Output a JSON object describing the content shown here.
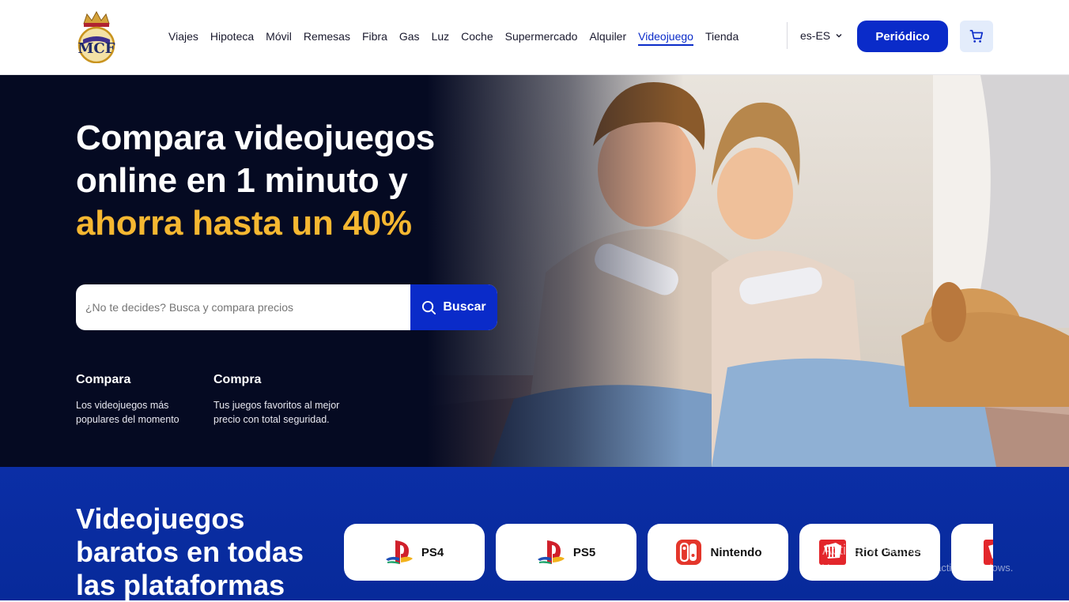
{
  "header": {
    "nav": [
      {
        "label": "Viajes"
      },
      {
        "label": "Hipoteca"
      },
      {
        "label": "Móvil"
      },
      {
        "label": "Remesas"
      },
      {
        "label": "Fibra"
      },
      {
        "label": "Gas"
      },
      {
        "label": "Luz"
      },
      {
        "label": "Coche"
      },
      {
        "label": "Supermercado"
      },
      {
        "label": "Alquiler"
      },
      {
        "label": "Videojuego",
        "active": true
      },
      {
        "label": "Tienda"
      }
    ],
    "language": "es-ES",
    "cta_label": "Periódico",
    "colors": {
      "brand": "#0a2bc9",
      "highlight": "#f5b731",
      "hero_bg": "#050a22"
    }
  },
  "hero": {
    "title_line1": "Compara videojuegos",
    "title_line2": "online en 1 minuto y",
    "title_highlight": "ahorra hasta un 40%",
    "search_placeholder": "¿No te decides? Busca y compara precios",
    "search_button": "Buscar",
    "features": [
      {
        "title": "Compara",
        "text": "Los videojuegos más populares del momento"
      },
      {
        "title": "Compra",
        "text": "Tus juegos favoritos al mejor precio con total seguridad."
      }
    ]
  },
  "platforms": {
    "title": "Videojuegos baratos en todas las plataformas",
    "items": [
      {
        "label": "PS4",
        "icon": "playstation-icon"
      },
      {
        "label": "PS5",
        "icon": "playstation-icon"
      },
      {
        "label": "Nintendo",
        "icon": "nintendo-switch-icon"
      },
      {
        "label": "Riot Games",
        "icon": "riot-games-icon"
      },
      {
        "label": "",
        "icon": "riot-games-icon"
      }
    ]
  },
  "os_overlay": {
    "line1": "Activar Windows",
    "line2": "Ve a Configuración para activar Windows."
  }
}
